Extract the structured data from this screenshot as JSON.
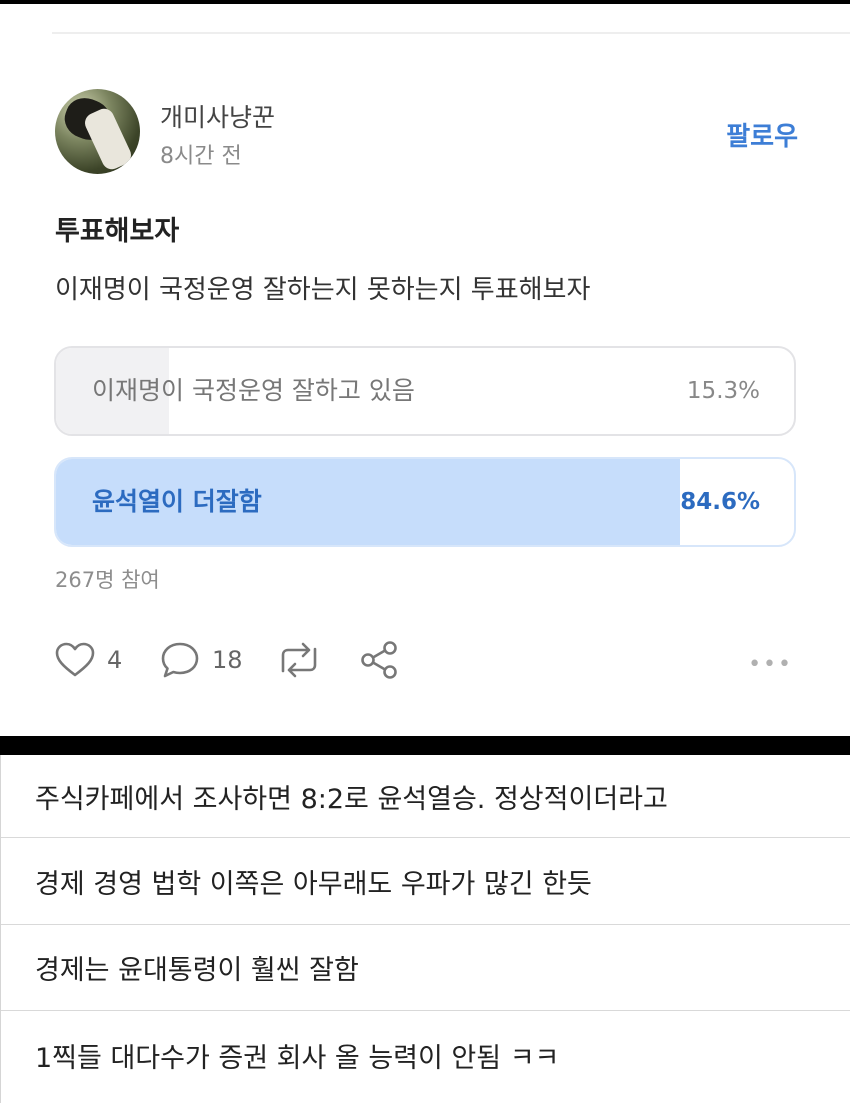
{
  "post": {
    "author": "개미사냥꾼",
    "time": "8시간 전",
    "follow_label": "팔로우",
    "title": "투표해보자",
    "body": "이재명이 국정운영 잘하는지 못하는지 투표해보자"
  },
  "poll": {
    "options": [
      {
        "label": "이재명이 국정운영 잘하고 있음",
        "percent_text": "15.3%",
        "percent": 15.3
      },
      {
        "label": "윤석열이 더잘함",
        "percent_text": "84.6%",
        "percent": 84.6
      }
    ],
    "participants": "267명 참여"
  },
  "actions": {
    "like_count": "4",
    "comment_count": "18",
    "more": "•••"
  },
  "icons": [
    "heart-icon",
    "comment-bubble-icon",
    "repost-icon",
    "share-icon"
  ],
  "colors": {
    "accent": "#3d7ed6",
    "poll_selected_fill": "#c6ddfb",
    "poll_other_fill": "#f1f1f3"
  },
  "comments": [
    "주식카페에서 조사하면 8:2로 윤석열승. 정상적이더라고",
    "경제 경영 법학 이쪽은 아무래도 우파가 많긴 한듯",
    "경제는 윤대통령이 훨씬 잘함",
    "1찍들 대다수가 증권 회사 올 능력이 안됨 ㅋㅋ"
  ]
}
